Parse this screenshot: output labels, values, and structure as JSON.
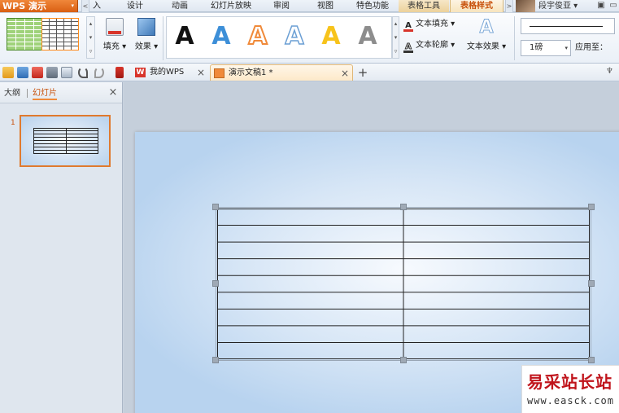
{
  "app": {
    "name": "WPS 演示",
    "dropdown_glyph": "▾"
  },
  "menubar": {
    "scroll_left": "<",
    "partial_item": "入",
    "items": [
      "设计",
      "动画",
      "幻灯片放映",
      "审阅",
      "视图",
      "特色功能"
    ],
    "tool_tab": "表格工具",
    "active_tab": "表格样式",
    "scroll_right": ">",
    "user_name": "段宇俊亚 ▾",
    "user_badge": "V",
    "icons": [
      "shirt-icon",
      "minimize-icon"
    ]
  },
  "ribbon": {
    "fill_label": "填充 ▾",
    "effect_label": "效果 ▾",
    "wordart_letters": [
      "A",
      "A",
      "A",
      "A",
      "A",
      "A"
    ],
    "text_fill_label": "文本填充 ▾",
    "text_outline_label": "文本轮廓 ▾",
    "text_effect_label": "文本效果 ▾",
    "line_weight_value": "1磅",
    "apply_to_label": "应用至：",
    "scroll_glyphs": [
      "▴",
      "▾",
      "▿"
    ]
  },
  "tabs": {
    "mywps_label": "我的WPS",
    "mywps_icon_glyph": "W",
    "doc_label": "演示文稿1 *",
    "close_glyph": "×",
    "add_glyph": "+"
  },
  "left_panel": {
    "tab_outline": "大纲",
    "tab_slides": "幻灯片",
    "close_glyph": "×",
    "slide_number": "1"
  },
  "slide_table": {
    "rows": 9,
    "cols": 2
  },
  "watermark": {
    "title": "易采站长站",
    "url": "www.easck.com"
  },
  "colors": {
    "accent": "#f08a3a",
    "active_text": "#c8500a",
    "watermark_red": "#c0141b"
  }
}
